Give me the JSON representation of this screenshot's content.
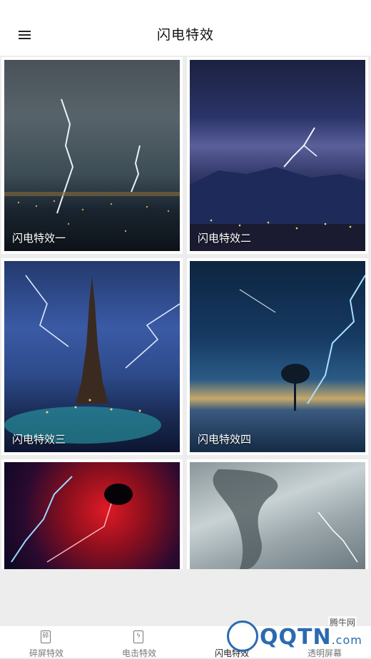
{
  "header": {
    "title": "闪电特效",
    "menu_icon": "hamburger-menu-icon"
  },
  "cards": [
    {
      "label": "闪电特效一"
    },
    {
      "label": "闪电特效二"
    },
    {
      "label": "闪电特效三"
    },
    {
      "label": "闪电特效四"
    },
    {
      "label": ""
    },
    {
      "label": ""
    }
  ],
  "bottom_nav": {
    "items": [
      {
        "label": "碎屏特效",
        "icon": "phone-cracked-icon",
        "active": false
      },
      {
        "label": "电击特效",
        "icon": "phone-bolt-icon",
        "active": false
      },
      {
        "label": "闪电特效",
        "icon": "lightning-icon",
        "active": true
      },
      {
        "label": "透明屏幕",
        "icon": "phone-transparent-icon",
        "active": false
      }
    ]
  },
  "watermark": {
    "brand": "QQTN",
    "suffix": ".com",
    "site": "腾牛网"
  }
}
